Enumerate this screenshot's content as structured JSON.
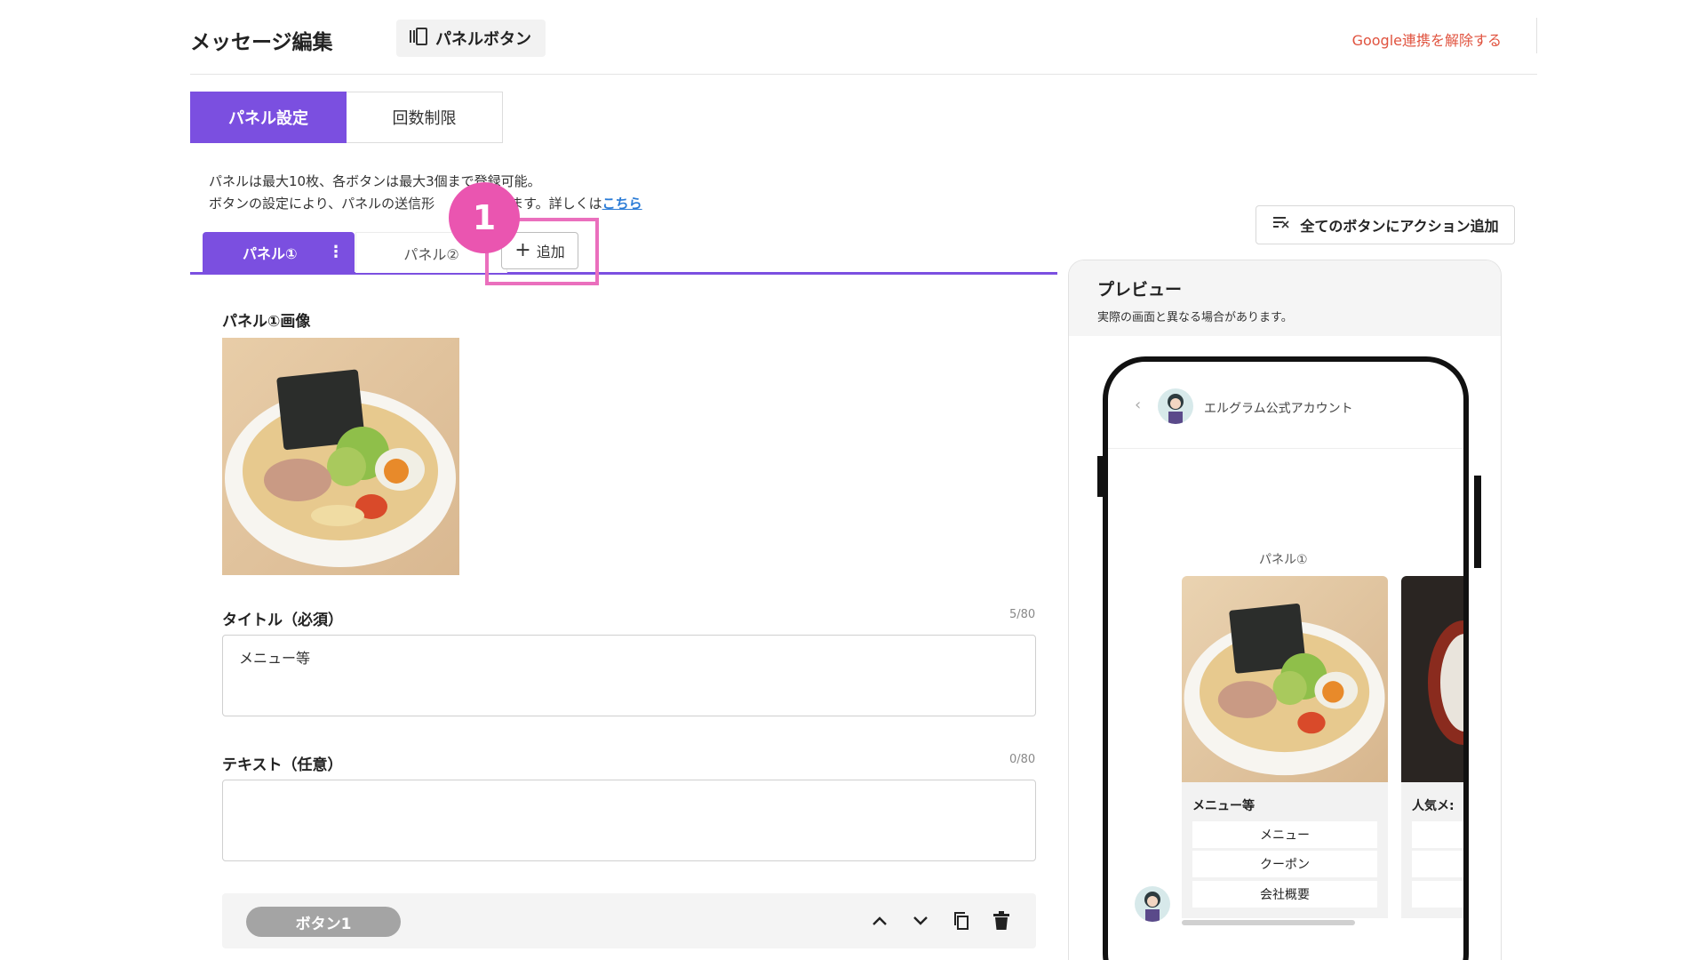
{
  "header": {
    "title": "メッセージ編集",
    "type_chip": "パネルボタン",
    "unlink_link": "Google連携を解除する"
  },
  "top_tabs": [
    {
      "label": "パネル設定",
      "active": true
    },
    {
      "label": "回数制限",
      "active": false
    }
  ],
  "info": {
    "line1": "パネルは最大10枚、各ボタンは最大3個まで登録可能。",
    "line2_prefix": "ボタンの設定により、パネルの送信形",
    "line2_suffix": "ります。詳しくは",
    "link": "こちら"
  },
  "action_all_button": "全てのボタンにアクション追加",
  "panel_tabs": [
    {
      "label": "パネル①",
      "active": true
    },
    {
      "label": "パネル②",
      "active": false
    }
  ],
  "add_button": "追加",
  "step_badge": "1",
  "form": {
    "image_label": "パネル①画像",
    "title_label": "タイトル（必須）",
    "title_counter": "5/80",
    "title_value": "メニュー等",
    "text_label": "テキスト（任意）",
    "text_counter": "0/80",
    "text_value": "",
    "button_pill": "ボタン1"
  },
  "preview": {
    "title": "プレビュー",
    "subtitle": "実際の画面と異なる場合があります。",
    "account_name": "エルグラム公式アカウント",
    "panel_label": "パネル①",
    "card_title": "メニュー等",
    "card_buttons": [
      "メニュー",
      "クーポン",
      "会社概要"
    ],
    "card2_title": "人気メ:"
  },
  "colors": {
    "accent": "#7b4fe0",
    "highlight": "#ea6fbd",
    "badge": "#ea55b0",
    "danger_link": "#e0533f"
  }
}
